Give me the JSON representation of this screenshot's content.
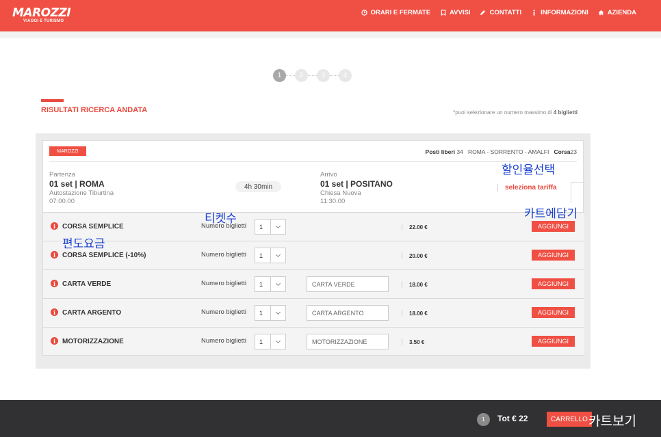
{
  "header": {
    "logo_name": "MAROZZI",
    "logo_sub": "VIAGGI E TURISMO",
    "nav": [
      {
        "label": "ORARI E FERMATE",
        "icon": "clock-icon"
      },
      {
        "label": "AVVISI",
        "icon": "bookmark-icon"
      },
      {
        "label": "CONTATTI",
        "icon": "pencil-icon"
      },
      {
        "label": "INFORMAZIONI",
        "icon": "info-icon"
      },
      {
        "label": "AZIENDA",
        "icon": "home-icon"
      }
    ]
  },
  "stepper": {
    "steps": [
      "1",
      "2",
      "3",
      "4"
    ],
    "active": 1
  },
  "section": {
    "title": "RISULTATI RICERCA ANDATA",
    "note_prefix": "*puoi selezionare un numero massimo di ",
    "note_bold": "4 biglietti"
  },
  "trip": {
    "operator": "MAROZZI",
    "posti_label": "Posti liberi",
    "posti_value": "34",
    "route": "ROMA - SORRENTO - AMALFI",
    "corsa_label": "Corsa",
    "corsa_value": "23",
    "departure": {
      "label": "Partenza",
      "main": "01 set | ROMA",
      "station": "Autostazione Tiburtina",
      "time": "07:00:00"
    },
    "duration": "4h 30min",
    "arrival": {
      "label": "Arrivo",
      "main": "01 set | POSITANO",
      "station": "Chiesa Nuova",
      "time": "11:30:00"
    },
    "select_tariff": "seleziona tariffa"
  },
  "fares": [
    {
      "name": "CORSA SEMPLICE",
      "qty_label": "Numero biglietti",
      "qty": "1",
      "input_placeholder": "",
      "price": "22.00 €",
      "button": "AGGIUNGI"
    },
    {
      "name": "CORSA SEMPLICE (-10%)",
      "qty_label": "Numero biglietti",
      "qty": "1",
      "input_placeholder": "",
      "price": "20.00 €",
      "button": "AGGIUNGI"
    },
    {
      "name": "CARTA VERDE",
      "qty_label": "Numero biglietti",
      "qty": "1",
      "input_placeholder": "CARTA VERDE",
      "price": "18.00 €",
      "button": "AGGIUNGI"
    },
    {
      "name": "CARTA ARGENTO",
      "qty_label": "Numero biglietti",
      "qty": "1",
      "input_placeholder": "CARTA ARGENTO",
      "price": "18.00 €",
      "button": "AGGIUNGI"
    },
    {
      "name": "MOTORIZZAZIONE",
      "qty_label": "Numero biglietti",
      "qty": "1",
      "input_placeholder": "MOTORIZZAZIONE",
      "price": "3.50 €",
      "button": "AGGIUNGI"
    }
  ],
  "annotations": {
    "discount_select": "할인율선택",
    "ticket_count": "티켓수",
    "add_to_cart": "카트에담기",
    "one_way_fare": "편도요금",
    "view_cart": "카트보기"
  },
  "cart": {
    "count": "1",
    "total": "Tot € 22",
    "button": "CARRELLO"
  },
  "colors": {
    "brand": "#f04f43",
    "annotation": "#1a40d0",
    "footer": "#313134"
  }
}
